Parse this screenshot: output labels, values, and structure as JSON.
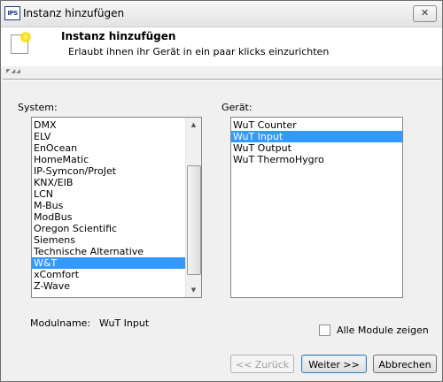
{
  "window": {
    "title": "Instanz hinzufügen",
    "app_icon_text": "IPS",
    "close_glyph": "✕"
  },
  "header": {
    "title": "Instanz hinzufügen",
    "subtitle": "Erlaubt ihnen ihr Gerät in ein paar klicks einzurichten"
  },
  "system": {
    "label": "System:",
    "items": [
      "DMX",
      "ELV",
      "EnOcean",
      "HomeMatic",
      "IP-Symcon/ProJet",
      "KNX/EIB",
      "LCN",
      "M-Bus",
      "ModBus",
      "Oregon Scientific",
      "Siemens",
      "Technische Alternative",
      "W&T",
      "xComfort",
      "Z-Wave"
    ],
    "selected": "W&T"
  },
  "device": {
    "label": "Gerät:",
    "items": [
      "WuT Counter",
      "WuT Input",
      "WuT Output",
      "WuT ThermoHygro"
    ],
    "selected": "WuT Input"
  },
  "module": {
    "label": "Modulname:",
    "value": "WuT Input"
  },
  "show_all": {
    "label": "Alle Module zeigen",
    "checked": false
  },
  "buttons": {
    "back": "<< Zurück",
    "next": "Weiter >>",
    "cancel": "Abbrechen"
  },
  "icons": {
    "scroll_up": "chevron-up-icon",
    "scroll_down": "chevron-down-icon",
    "wizard": "new-item-wizard-icon"
  }
}
